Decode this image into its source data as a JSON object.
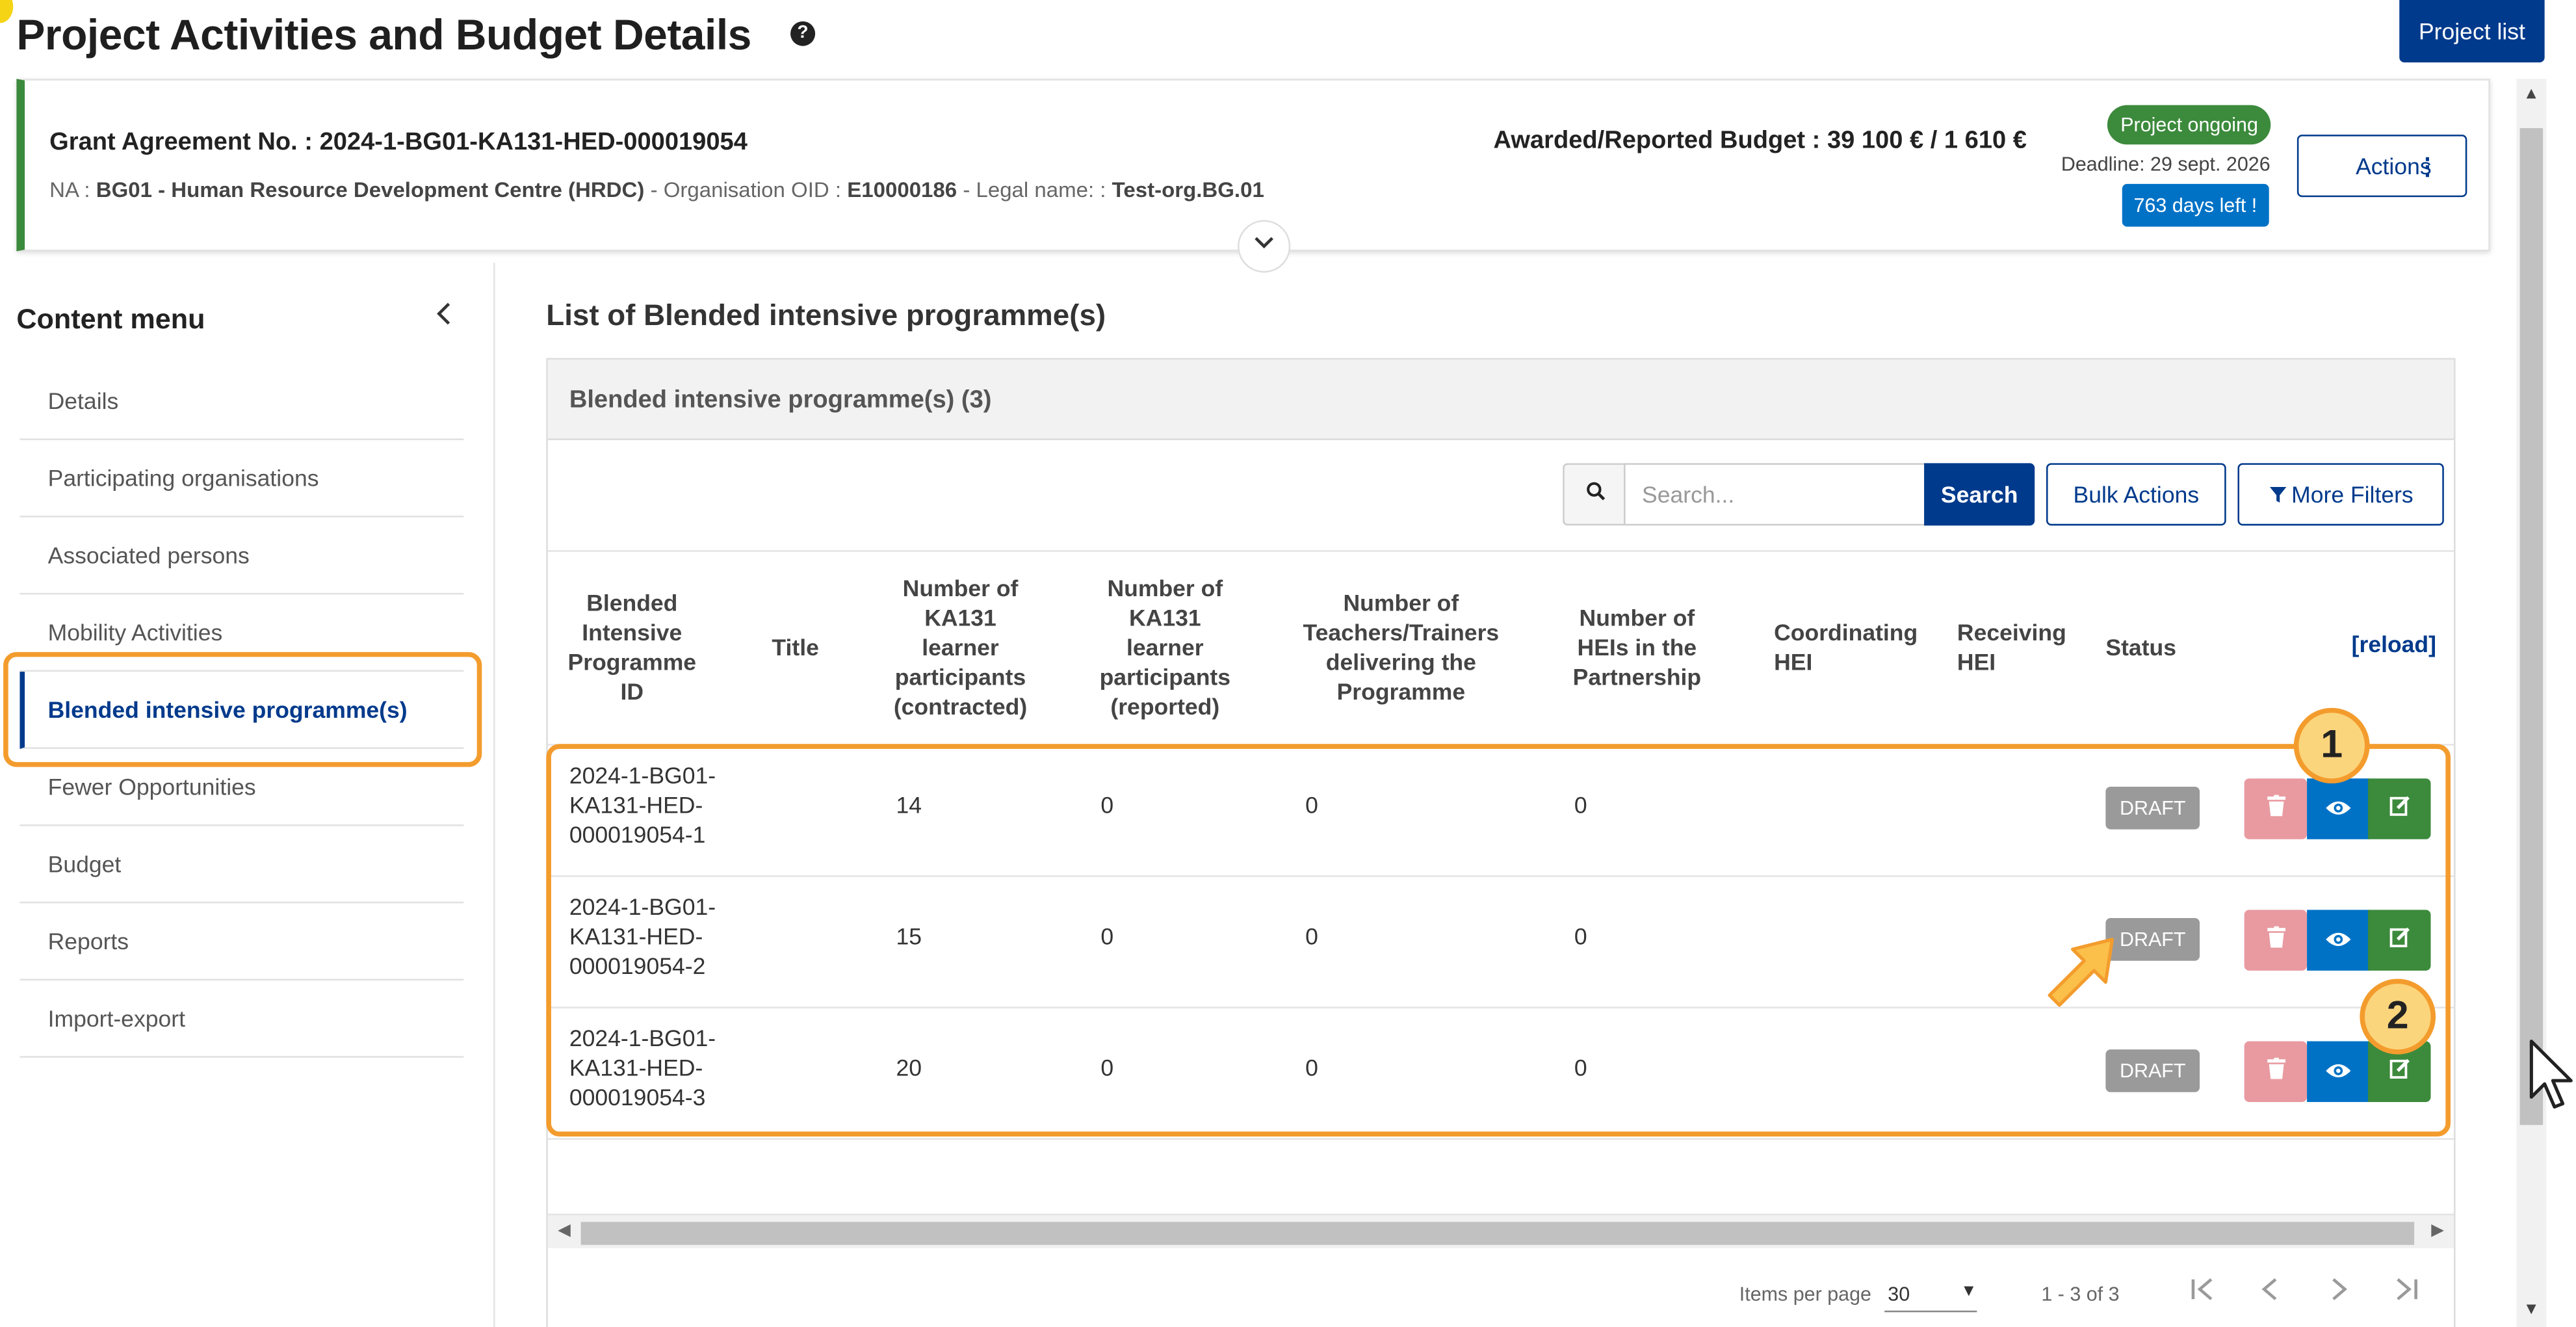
{
  "header": {
    "title": "Project Activities and Budget Details",
    "help_glyph": "?",
    "project_list_label": "Project list"
  },
  "grant": {
    "grant_no": "Grant Agreement No. : 2024-1-BG01-KA131-HED-000019054",
    "na_prefix": "NA :",
    "na_value": "BG01 - Human Resource Development Centre (HRDC)",
    "oid_prefix": " - Organisation OID :",
    "oid_value": "E10000186",
    "legal_prefix": " - Legal name: :",
    "legal_value": "Test-org.BG.01",
    "budget": "Awarded/Reported Budget : 39 100 € / 1 610 €",
    "status_badge": "Project ongoing",
    "deadline": "Deadline: 29 sept. 2026",
    "days_left": "763 days left !",
    "actions_label": "Actions",
    "actions_kebab": "⋮"
  },
  "sidebar": {
    "title": "Content menu",
    "items": [
      {
        "label": "Details"
      },
      {
        "label": "Participating organisations"
      },
      {
        "label": "Associated persons"
      },
      {
        "label": "Mobility Activities"
      },
      {
        "label": "Blended intensive programme(s)",
        "active": true
      },
      {
        "label": "Fewer Opportunities"
      },
      {
        "label": "Budget"
      },
      {
        "label": "Reports"
      },
      {
        "label": "Import-export"
      }
    ]
  },
  "main": {
    "list_title": "List of Blended intensive programme(s)",
    "panel_title": "Blended intensive programme(s) (3)",
    "search": {
      "placeholder": "Search...",
      "button": "Search"
    },
    "bulk_actions": "Bulk Actions",
    "more_filters": "More Filters",
    "reload": "[reload]",
    "columns": [
      "Blended Intensive Programme ID",
      "Title",
      "Number of KA131 learner participants (contracted)",
      "Number of KA131 learner participants (reported)",
      "Number of Teachers/Trainers delivering the Programme",
      "Number of HEIs in the Partnership",
      "Coordinating HEI",
      "Receiving HEI",
      "Status"
    ],
    "rows": [
      {
        "id_1": "2024-1-BG01-",
        "id_2": "KA131-HED-",
        "id_3": "000019054-1",
        "title": "",
        "contracted": "14",
        "reported": "0",
        "teachers": "0",
        "heis": "0",
        "coordinating": "",
        "receiving": "",
        "status": "DRAFT"
      },
      {
        "id_1": "2024-1-BG01-",
        "id_2": "KA131-HED-",
        "id_3": "000019054-2",
        "title": "",
        "contracted": "15",
        "reported": "0",
        "teachers": "0",
        "heis": "0",
        "coordinating": "",
        "receiving": "",
        "status": "DRAFT"
      },
      {
        "id_1": "2024-1-BG01-",
        "id_2": "KA131-HED-",
        "id_3": "000019054-3",
        "title": "",
        "contracted": "20",
        "reported": "0",
        "teachers": "0",
        "heis": "0",
        "coordinating": "",
        "receiving": "",
        "status": "DRAFT"
      }
    ],
    "pagination": {
      "items_per_page_label": "Items per page",
      "items_per_page_value": "30",
      "range": "1 - 3 of 3"
    }
  },
  "callouts": [
    "1",
    "2"
  ],
  "colors": {
    "primary": "#003a8c",
    "success": "#3c8a3c",
    "info": "#0072c6",
    "danger_light": "#e89aa0",
    "highlight": "#f39c2d"
  }
}
